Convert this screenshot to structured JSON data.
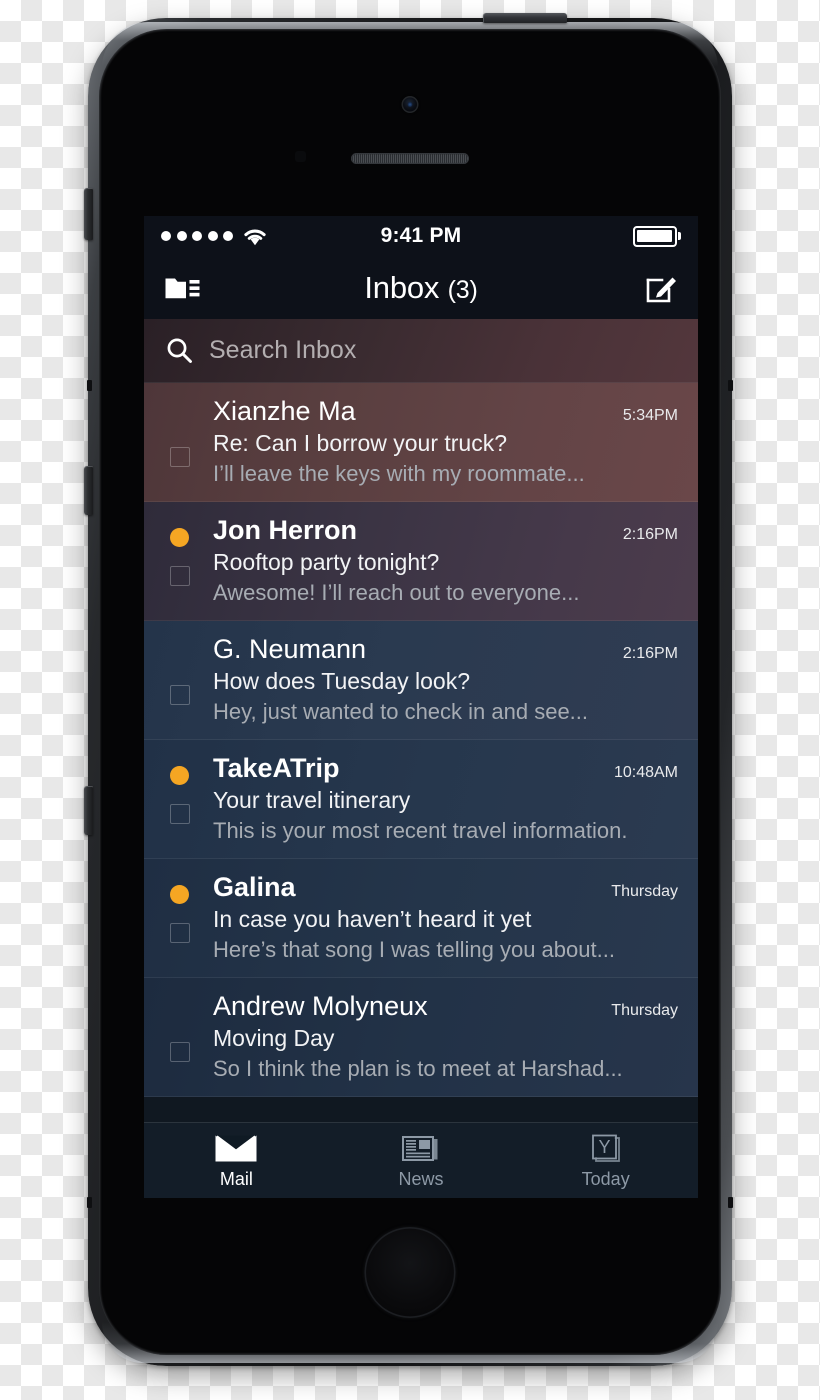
{
  "device": {
    "name": "iphone-5s-space-gray",
    "hardware": {
      "camera": "front-camera",
      "earpiece": "earpiece-speaker",
      "home_button": "home-button",
      "power_button": "power-button",
      "mute_switch": "mute-switch",
      "volume_up": "volume-up-button",
      "volume_down": "volume-down-button"
    }
  },
  "status_bar": {
    "signal_dots": 5,
    "signal_icon": "signal-dots-icon",
    "wifi_icon": "wifi-icon",
    "time": "9:41 PM",
    "battery_icon": "battery-icon",
    "battery_level": 100
  },
  "nav_bar": {
    "folder_icon": "folder-list-icon",
    "title": "Inbox",
    "unread_count": "(3)",
    "compose_icon": "compose-icon"
  },
  "search": {
    "icon": "search-icon",
    "placeholder": "Search Inbox",
    "value": ""
  },
  "colors": {
    "unread_dot": "#F5A623",
    "accent_text": "#FFFFFF",
    "preview_text": "#A7ACB3",
    "tab_active": "#FFFFFF",
    "tab_inactive": "#8D99A6",
    "tab_bar_bg": "#131D28",
    "nav_bg": "#0D1119"
  },
  "mail_list": [
    {
      "sender": "Xianzhe Ma",
      "subject": "Re: Can I borrow your truck?",
      "preview": "I’ll leave the keys with my roommate...",
      "time": "5:34PM",
      "unread": false,
      "checked": false,
      "row_bg": "linear-gradient(105deg, #4e3639 0%, #5a3f40 35%, #634446 68%, #6a4749 100%)"
    },
    {
      "sender": "Jon Herron",
      "subject": "Rooftop party tonight?",
      "preview": "Awesome! I’ll reach out to everyone...",
      "time": "2:16PM",
      "unread": true,
      "checked": false,
      "row_bg": "linear-gradient(105deg, #2f2b3a 0%, #3b3444 40%, #46394a 75%, #4c3c4c 100%)"
    },
    {
      "sender": "G. Neumann",
      "subject": "How does Tuesday look?",
      "preview": "Hey, just wanted to check in and see...",
      "time": "2:16PM",
      "unread": false,
      "checked": false,
      "row_bg": "linear-gradient(105deg, #24344a 0%, #2a3a50 45%, #303c52 100%)"
    },
    {
      "sender": "TakeATrip",
      "subject": "Your travel itinerary",
      "preview": "This is your most recent travel information.",
      "time": "10:48AM",
      "unread": true,
      "checked": false,
      "row_bg": "linear-gradient(105deg, #213147 0%, #26374d 50%, #2b3a50 100%)"
    },
    {
      "sender": "Galina",
      "subject": "In case you haven’t heard it yet",
      "preview": "Here’s that song I was telling you about...",
      "time": "Thursday",
      "unread": true,
      "checked": false,
      "row_bg": "linear-gradient(105deg, #1f2e43 0%, #24354a 50%, #29384e 100%)"
    },
    {
      "sender": "Andrew Molyneux",
      "subject": "Moving Day",
      "preview": "So I think the plan is to meet at Harshad...",
      "time": "Thursday",
      "unread": false,
      "checked": false,
      "row_bg": "linear-gradient(105deg, #1d2b3f 0%, #223247 50%, #27354b 100%)"
    }
  ],
  "tab_bar": [
    {
      "label": "Mail",
      "icon": "mail-envelope-icon",
      "active": true
    },
    {
      "label": "News",
      "icon": "news-paper-icon",
      "active": false
    },
    {
      "label": "Today",
      "icon": "yahoo-today-icon",
      "active": false
    }
  ]
}
